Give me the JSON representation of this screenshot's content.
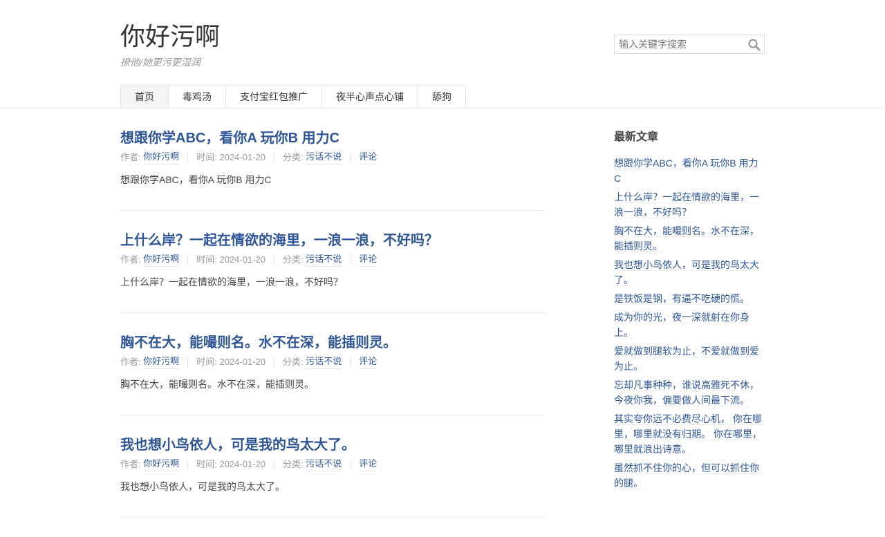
{
  "header": {
    "title": "你好污啊",
    "description": "撩他/她更污更湿润",
    "search_placeholder": "输入关键字搜索"
  },
  "nav": {
    "items": [
      {
        "label": "首页",
        "active": true
      },
      {
        "label": "毒鸡汤"
      },
      {
        "label": "支付宝红包推广"
      },
      {
        "label": "夜半心声点心铺"
      },
      {
        "label": "舔狗"
      }
    ]
  },
  "posts": [
    {
      "title": "想跟你学ABC，看你A 玩你B 用力C",
      "author_label": "作者:",
      "author": "你好污啊",
      "time_label": "时间: 2024-01-20",
      "category_label": "分类:",
      "category": "污话不说",
      "comment": "评论",
      "excerpt": "想跟你学ABC，看你A 玩你B 用力C"
    },
    {
      "title": "上什么岸？一起在情欲的海里，一浪一浪，不好吗？",
      "author_label": "作者:",
      "author": "你好污啊",
      "time_label": "时间: 2024-01-20",
      "category_label": "分类:",
      "category": "污话不说",
      "comment": "评论",
      "excerpt": "上什么岸？一起在情欲的海里，一浪一浪，不好吗？"
    },
    {
      "title": "胸不在大，能嘬则名。水不在深，能插则灵。",
      "author_label": "作者:",
      "author": "你好污啊",
      "time_label": "时间: 2024-01-20",
      "category_label": "分类:",
      "category": "污话不说",
      "comment": "评论",
      "excerpt": "胸不在大，能嘬则名。水不在深，能插则灵。"
    },
    {
      "title": "我也想小鸟依人，可是我的鸟太大了。",
      "author_label": "作者:",
      "author": "你好污啊",
      "time_label": "时间: 2024-01-20",
      "category_label": "分类:",
      "category": "污话不说",
      "comment": "评论",
      "excerpt": "我也想小鸟依人，可是我的鸟太大了。"
    }
  ],
  "sidebar": {
    "widget_title": "最新文章",
    "recent": [
      "想跟你学ABC，看你A 玩你B 用力C",
      "上什么岸？一起在情欲的海里，一浪一浪，不好吗？",
      "胸不在大，能嘬则名。水不在深，能插则灵。",
      "我也想小鸟依人，可是我的鸟太大了。",
      "是铁饭是钢，有逼不吃硬的慌。",
      "成为你的光，夜一深就射在你身上。",
      "爱就做到腿软为止，不爱就做到爱为止。",
      "忘却凡事种种，谁说高雅死不休，今夜你我，偏要做人间最下流。",
      "其实夸你远不必费尽心机， 你在哪里，哪里就没有归期。 你在哪里，哪里就浪出诗意。",
      "虽然抓不住你的心，但可以抓住你的腿。"
    ]
  },
  "colors": {
    "link": "#2e5597",
    "text": "#333333",
    "muted": "#999999",
    "border": "#e5e5e5"
  }
}
